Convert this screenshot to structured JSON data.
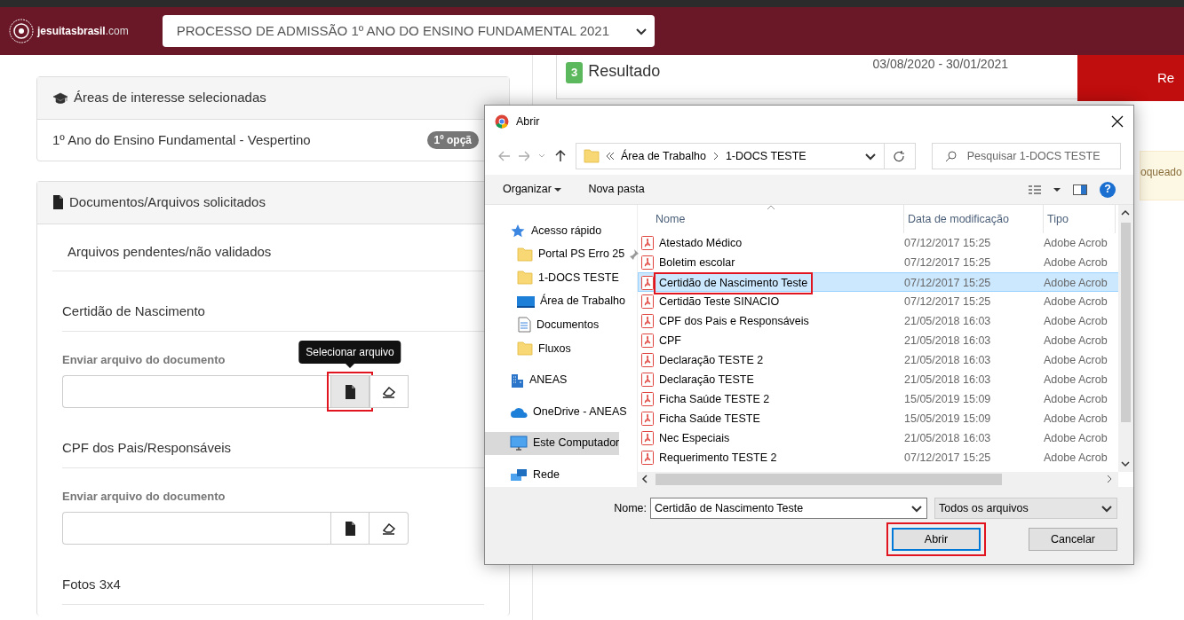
{
  "header": {
    "logo_text": "jesuitasbrasil",
    "logo_suffix": ".com",
    "process_select": "PROCESSO DE ADMISSÃO 1º ANO DO ENSINO FUNDAMENTAL 2021"
  },
  "interest_card": {
    "title": "Áreas de interesse selecionadas",
    "item": "1º Ano do Ensino Fundamental - Vespertino",
    "badge": "1º opçã"
  },
  "documents_card": {
    "title": "Documentos/Arquivos solicitados",
    "section": "Arquivos pendentes/não validados",
    "documents": [
      {
        "title": "Certidão de Nascimento",
        "upload_label": "Enviar arquivo do documento",
        "highlighted": true,
        "tooltip": "Selecionar arquivo"
      },
      {
        "title": "CPF dos Pais/Responsáveis",
        "upload_label": "Enviar arquivo do documento",
        "highlighted": false
      },
      {
        "title": "Fotos 3x4"
      }
    ]
  },
  "result_step": {
    "number": "3",
    "title": "Resultado",
    "dates": "03/08/2020 - 30/01/2021",
    "button": "Re",
    "alert": "oqueado"
  },
  "dialog": {
    "title": "Abrir",
    "path": [
      "Área de Trabalho",
      "1-DOCS TESTE"
    ],
    "search_placeholder": "Pesquisar 1-DOCS TESTE",
    "toolbar": [
      "Organizar",
      "Nova pasta"
    ],
    "help": "?",
    "nav": [
      {
        "label": "Acesso rápido",
        "kind": "star",
        "selected": false,
        "pinned": false
      },
      {
        "label": "Portal PS Erro 25",
        "kind": "folder",
        "selected": false,
        "pinned": true
      },
      {
        "label": "1-DOCS TESTE",
        "kind": "folder",
        "selected": false,
        "pinned": false
      },
      {
        "label": "Área de Trabalho",
        "kind": "desktop",
        "selected": false,
        "pinned": false
      },
      {
        "label": "Documentos",
        "kind": "document",
        "selected": false,
        "pinned": false
      },
      {
        "label": "Fluxos",
        "kind": "folder",
        "selected": false,
        "pinned": false
      },
      {
        "label": "ANEAS",
        "kind": "building",
        "selected": false,
        "pinned": false
      },
      {
        "label": "OneDrive - ANEAS",
        "kind": "cloud",
        "selected": false,
        "pinned": false
      },
      {
        "label": "Este Computador",
        "kind": "computer",
        "selected": true,
        "pinned": false
      },
      {
        "label": "Rede",
        "kind": "network",
        "selected": false,
        "pinned": false
      }
    ],
    "columns": [
      "Nome",
      "Data de modificação",
      "Tipo"
    ],
    "files": [
      {
        "name": "Atestado Médico",
        "date": "07/12/2017 15:25",
        "type": "Adobe Acrob",
        "selected": false,
        "highlighted": false
      },
      {
        "name": "Boletim escolar",
        "date": "07/12/2017 15:25",
        "type": "Adobe Acrob",
        "selected": false,
        "highlighted": false
      },
      {
        "name": "Certidão de Nascimento Teste",
        "date": "07/12/2017 15:25",
        "type": "Adobe Acrob",
        "selected": true,
        "highlighted": true
      },
      {
        "name": "Certidão Teste SINACIO",
        "date": "07/12/2017 15:25",
        "type": "Adobe Acrob",
        "selected": false,
        "highlighted": false
      },
      {
        "name": "CPF dos Pais e Responsáveis",
        "date": "21/05/2018 16:03",
        "type": "Adobe Acrob",
        "selected": false,
        "highlighted": false
      },
      {
        "name": "CPF",
        "date": "21/05/2018 16:03",
        "type": "Adobe Acrob",
        "selected": false,
        "highlighted": false
      },
      {
        "name": "Declaração TESTE 2",
        "date": "21/05/2018 16:03",
        "type": "Adobe Acrob",
        "selected": false,
        "highlighted": false
      },
      {
        "name": "Declaração TESTE",
        "date": "21/05/2018 16:03",
        "type": "Adobe Acrob",
        "selected": false,
        "highlighted": false
      },
      {
        "name": "Ficha Saúde TESTE 2",
        "date": "15/05/2019 15:09",
        "type": "Adobe Acrob",
        "selected": false,
        "highlighted": false
      },
      {
        "name": "Ficha Saúde TESTE",
        "date": "15/05/2019 15:09",
        "type": "Adobe Acrob",
        "selected": false,
        "highlighted": false
      },
      {
        "name": "Nec Especiais",
        "date": "21/05/2018 16:03",
        "type": "Adobe Acrob",
        "selected": false,
        "highlighted": false
      },
      {
        "name": "Requerimento TESTE 2",
        "date": "07/12/2017 15:25",
        "type": "Adobe Acrob",
        "selected": false,
        "highlighted": false
      }
    ],
    "name_label": "Nome:",
    "name_value": "Certidão de Nascimento Teste",
    "filter": "Todos os arquivos",
    "buttons": [
      {
        "label": "Abrir",
        "kind": "primary",
        "highlighted": true
      },
      {
        "label": "Cancelar",
        "kind": "secondary",
        "highlighted": false
      }
    ]
  }
}
